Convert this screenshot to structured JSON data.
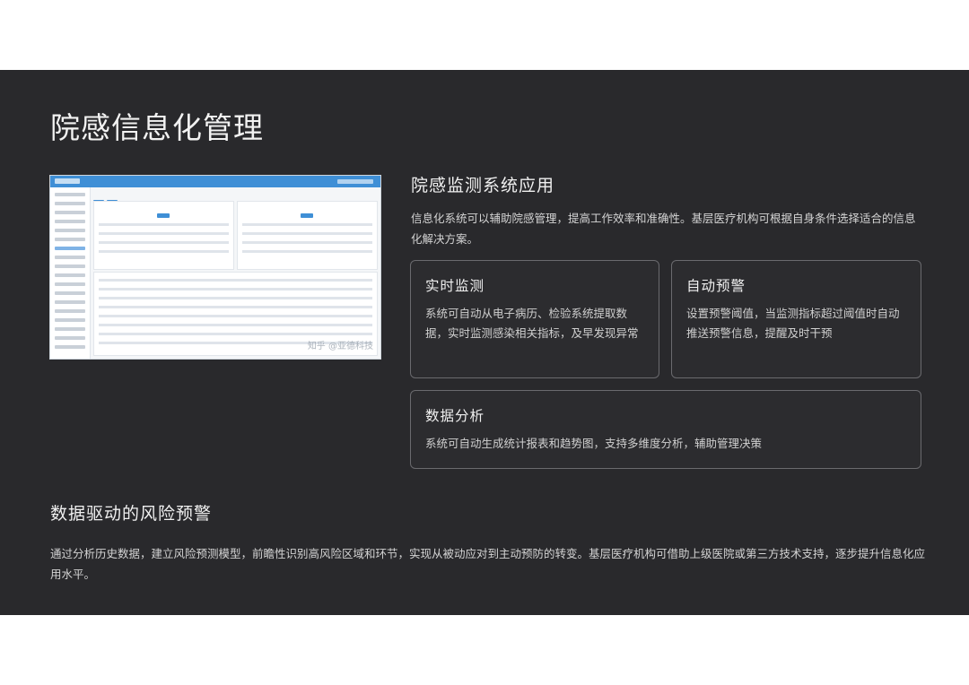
{
  "title": "院感信息化管理",
  "screenshot": {
    "watermark": "知乎 @亚德科技"
  },
  "monitoring_section": {
    "title": "院感监测系统应用",
    "description": "信息化系统可以辅助院感管理，提高工作效率和准确性。基层医疗机构可根据自身条件选择适合的信息化解决方案。"
  },
  "cards": [
    {
      "title": "实时监测",
      "text": "系统可自动从电子病历、检验系统提取数据，实时监测感染相关指标，及早发现异常"
    },
    {
      "title": "自动预警",
      "text": "设置预警阈值，当监测指标超过阈值时自动推送预警信息，提醒及时干预"
    },
    {
      "title": "数据分析",
      "text": "系统可自动生成统计报表和趋势图，支持多维度分析，辅助管理决策"
    }
  ],
  "risk_section": {
    "title": "数据驱动的风险预警",
    "description": "通过分析历史数据，建立风险预测模型，前瞻性识别高风险区域和环节，实现从被动应对到主动预防的转变。基层医疗机构可借助上级医院或第三方技术支持，逐步提升信息化应用水平。"
  },
  "colors": {
    "background": "#29292c",
    "card_border": "#6a6a6e",
    "accent_blue": "#3f8fd6"
  }
}
